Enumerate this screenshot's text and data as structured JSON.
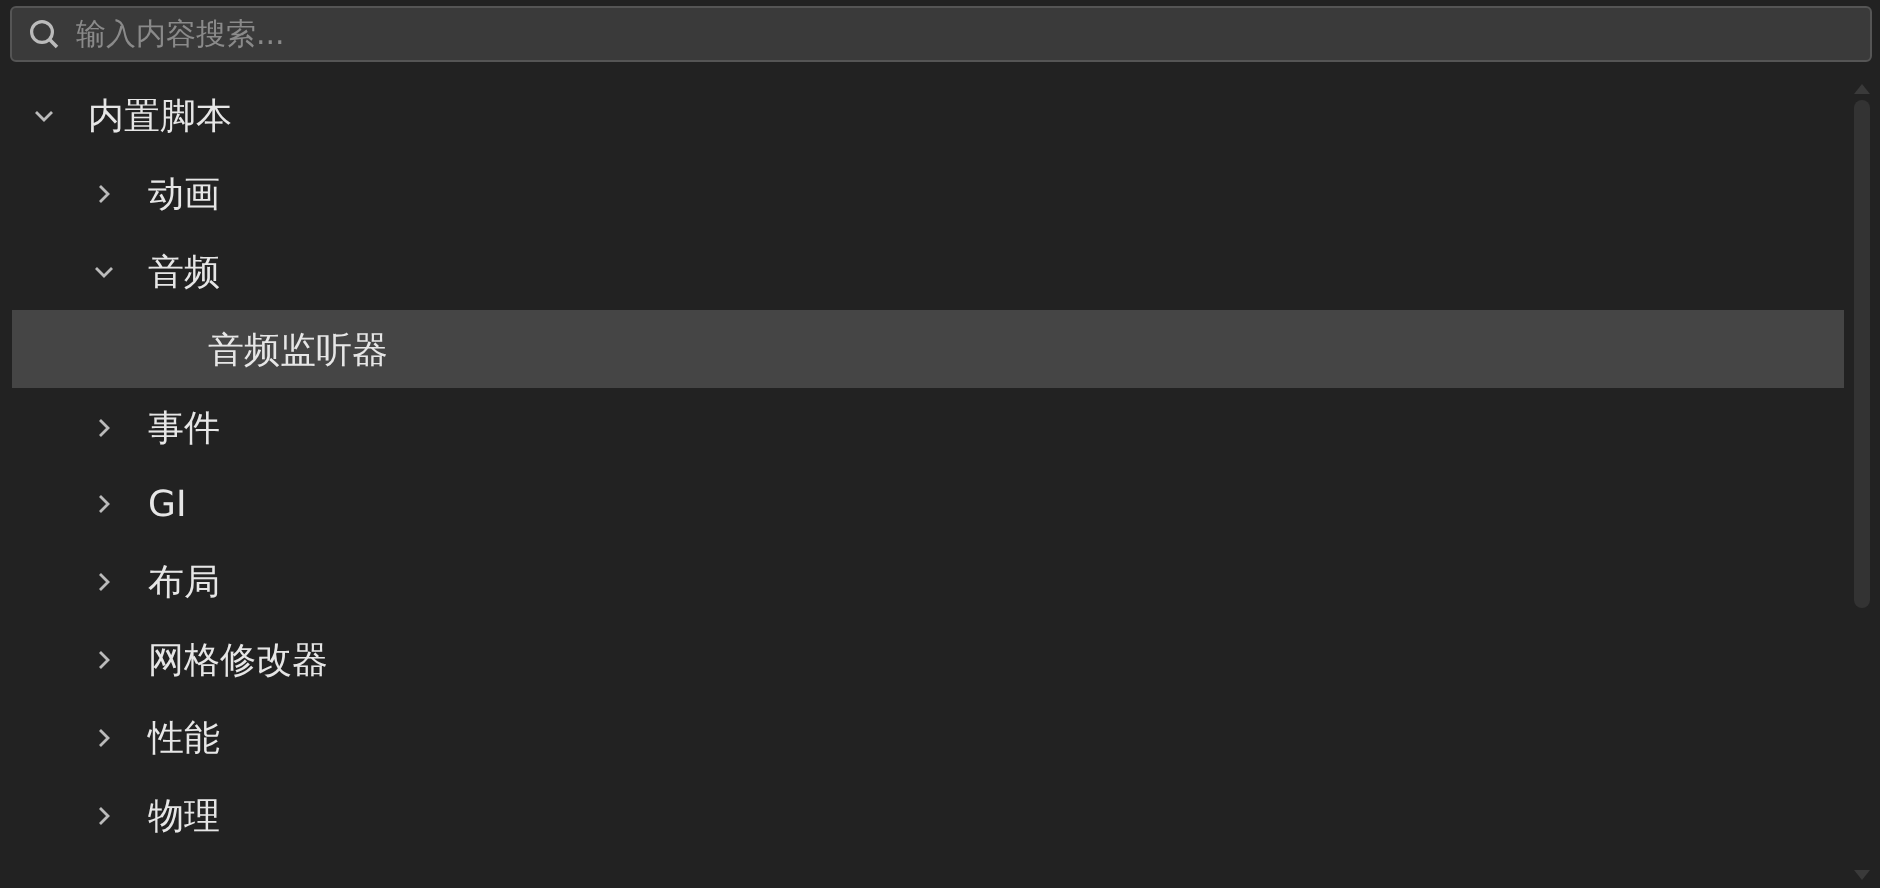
{
  "search": {
    "placeholder": "输入内容搜索..."
  },
  "tree": [
    {
      "label": "内置脚本",
      "expanded": true,
      "selected": false,
      "children": [
        {
          "label": "动画",
          "expanded": false,
          "selected": false
        },
        {
          "label": "音频",
          "expanded": true,
          "selected": false,
          "children": [
            {
              "label": "音频监听器",
              "selected": true
            }
          ]
        },
        {
          "label": "事件",
          "expanded": false,
          "selected": false
        },
        {
          "label": "GI",
          "expanded": false,
          "selected": false
        },
        {
          "label": "布局",
          "expanded": false,
          "selected": false
        },
        {
          "label": "网格修改器",
          "expanded": false,
          "selected": false
        },
        {
          "label": "性能",
          "expanded": false,
          "selected": false
        },
        {
          "label": "物理",
          "expanded": false,
          "selected": false
        }
      ]
    }
  ]
}
